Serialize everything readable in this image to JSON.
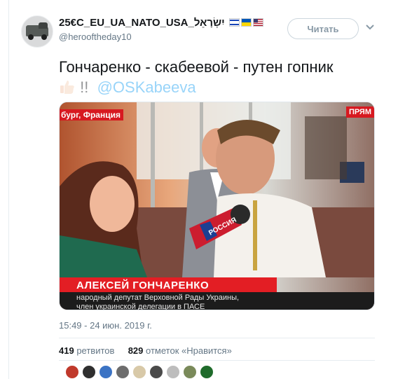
{
  "user": {
    "display_name": "25€С_EU_UA_NATO_USA_יִשְׂרָאֵל",
    "handle": "@herooftheday10",
    "flags": [
      "israel-flag",
      "ukraine-flag",
      "usa-flag"
    ]
  },
  "follow_button": {
    "label": "Читать"
  },
  "tweet": {
    "text": "Гончаренко - скабеевой - путен гопник",
    "exclamation": "!!",
    "mention": "@OSKabeeva",
    "emoji": "thumbs-up"
  },
  "media": {
    "location_caption": "бург, Франция",
    "live_label": "ПРЯМ",
    "mic_label": "РОССИЯ",
    "speaker_name": "АЛЕКСЕЙ ГОНЧАРЕНКО",
    "speaker_role_1": "народный депутат Верховной Рады Украины,",
    "speaker_role_2": "член украинской делегации в ПАСЕ"
  },
  "timestamp": "15:49 - 24 июн. 2019 г.",
  "stats": {
    "retweets_count": "419",
    "retweets_label": "ретвитов",
    "likes_count": "829",
    "likes_label": "отметок «Нравится»"
  },
  "likers": [
    {
      "color": "#c0392b"
    },
    {
      "color": "#2f2f2f"
    },
    {
      "color": "#3b73c4"
    },
    {
      "color": "#6d6d6d"
    },
    {
      "color": "#d8c9a8"
    },
    {
      "color": "#4a4a4a"
    },
    {
      "color": "#bdbdbd"
    },
    {
      "color": "#7a8a5a"
    },
    {
      "color": "#1f6b2b"
    }
  ],
  "colors": {
    "accent": "#1da1f2",
    "muted": "#657786",
    "border": "#e6ecf0",
    "news_red": "#e31e24"
  }
}
